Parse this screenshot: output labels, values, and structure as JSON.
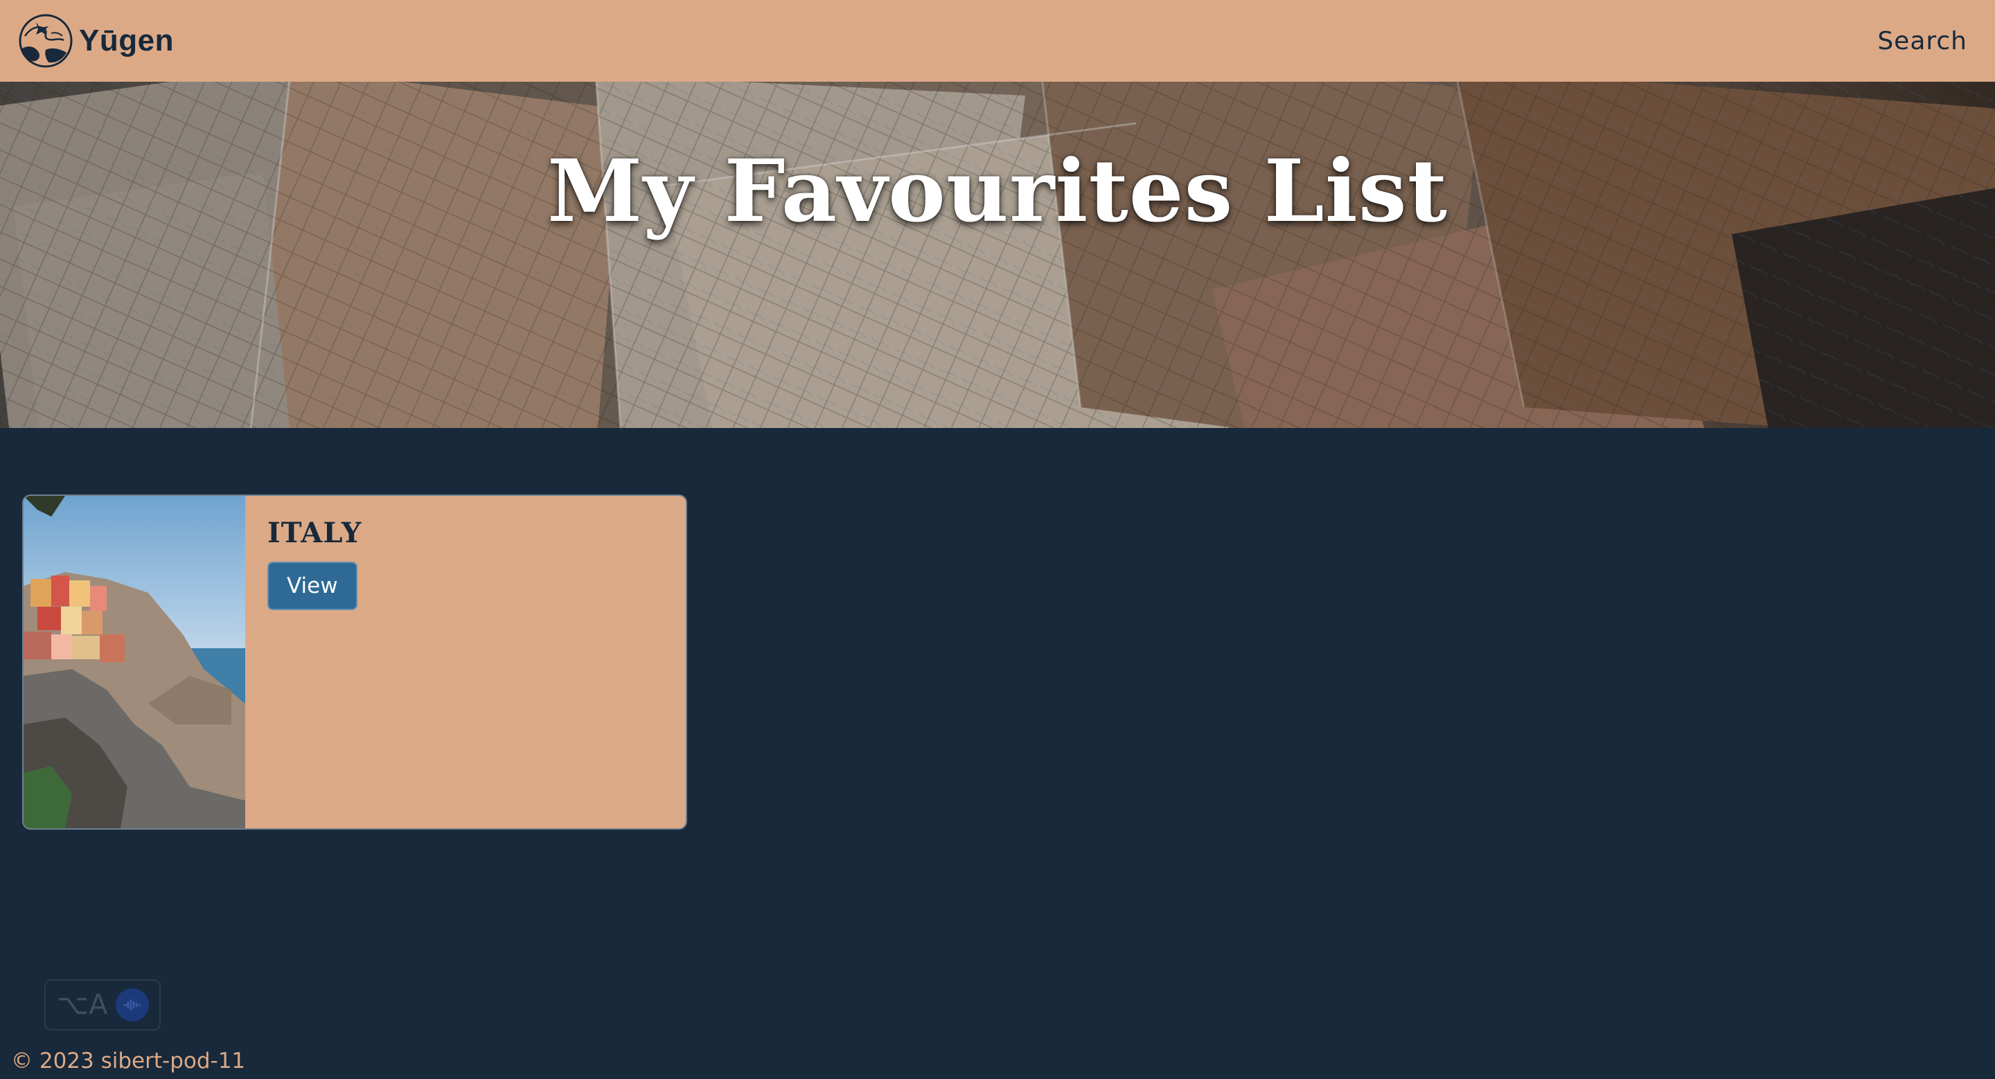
{
  "navbar": {
    "brand_name": "Yūgen",
    "search_label": "Search"
  },
  "hero": {
    "title": "My Favourites List"
  },
  "favourites": [
    {
      "name": "ITALY",
      "view_label": "View"
    }
  ],
  "ime_widget": {
    "label": "⌥A"
  },
  "footer": {
    "copyright": "© 2023 sibert-pod-11"
  },
  "colors": {
    "navbar_bg": "#dca987",
    "page_bg": "#17293a",
    "card_bg": "#dca987",
    "button_bg": "#2e6a95",
    "text_dark": "#17293a",
    "footer_text": "#dca987"
  },
  "icons": {
    "brand_logo": "globe-plane-logo",
    "voice": "voice-waveform-icon"
  }
}
